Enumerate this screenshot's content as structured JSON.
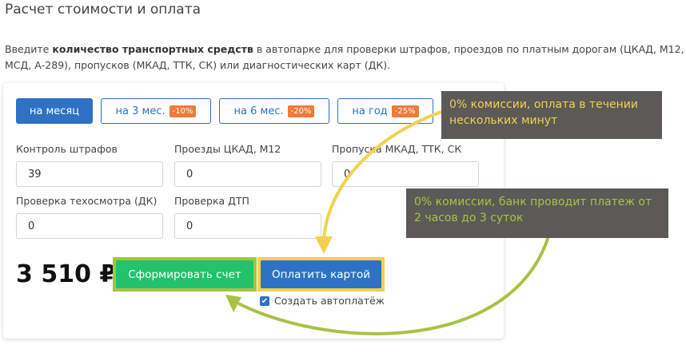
{
  "page_title": "Расчет стоимости и оплата",
  "intro": {
    "before": "Введите ",
    "bold": "количество транспортных средств",
    "after": " в автопарке для проверки штрафов, проездов по платным дорогам (ЦКАД, М12, МСД, А-289), пропусков (МКАД, ТТК, СК) или диагностических карт (ДК)."
  },
  "periods": [
    {
      "label": "на месяц",
      "discount": ""
    },
    {
      "label": "на 3 мес.",
      "discount": "-10%"
    },
    {
      "label": "на 6 мес.",
      "discount": "-20%"
    },
    {
      "label": "на год",
      "discount": "-25%"
    }
  ],
  "fields": {
    "fines": {
      "label": "Контроль штрафов",
      "value": "39"
    },
    "toll": {
      "label": "Проезды ЦКАД, М12",
      "value": "0"
    },
    "pass": {
      "label": "Пропуска МКАД, ТТК, СК",
      "value": "0"
    },
    "inspection": {
      "label": "Проверка техосмотра (ДК)",
      "value": "0"
    },
    "accident": {
      "label": "Проверка ДТП",
      "value": "0"
    }
  },
  "total": "3 510 ₽",
  "buttons": {
    "invoice": "Сформировать счет",
    "card": "Оплатить картой"
  },
  "autopay": {
    "label": "Создать автоплатёж",
    "checked": true
  },
  "callouts": {
    "card": "0% комиссии, оплата в течении нескольких минут",
    "invoice": "0% комиссии, банк проводит платеж от 2 часов до 3 суток"
  },
  "colors": {
    "accent_blue": "#2d72c4",
    "discount_orange": "#f07a3a",
    "invoice_green": "#22c36b",
    "highlight_yellow": "#f3d150",
    "highlight_green": "#a6c443",
    "callout_bg": "#5b5a57"
  }
}
